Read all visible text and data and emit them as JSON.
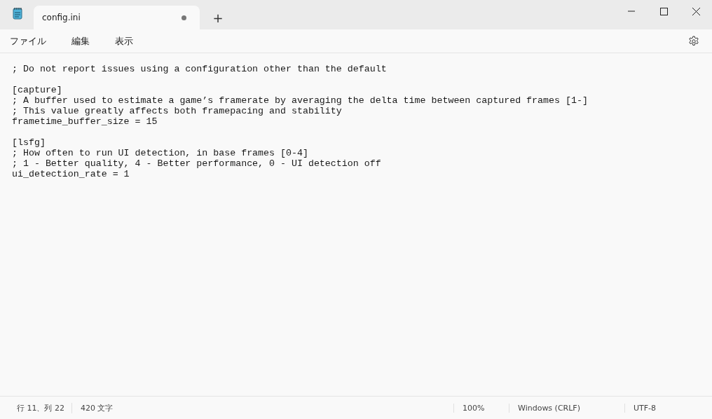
{
  "tab": {
    "title": "config.ini",
    "modified": true,
    "new_tab": "+"
  },
  "menu": [
    "ファイル",
    "編集",
    "表示"
  ],
  "editor": {
    "blocks": [
      [
        "; Do not report issues using a configuration other than the default"
      ],
      [
        "[capture]",
        "; A buffer used to estimate a game’s framerate by averaging the delta time between captured frames [1-]",
        "; This value greatly affects both framepacing and stability",
        "frametime_buffer_size = 15"
      ],
      [
        "[lsfg]",
        "; How often to run UI detection, in base frames [0-4]",
        "; 1 - Better quality, 4 - Better performance, 0 - UI detection off",
        "ui_detection_rate = 1"
      ]
    ]
  },
  "status_bar": {
    "position": "行 11、列 22",
    "count": "420 文字",
    "zoom": "100%",
    "line_ending": "Windows (CRLF)",
    "encoding": "UTF-8"
  }
}
